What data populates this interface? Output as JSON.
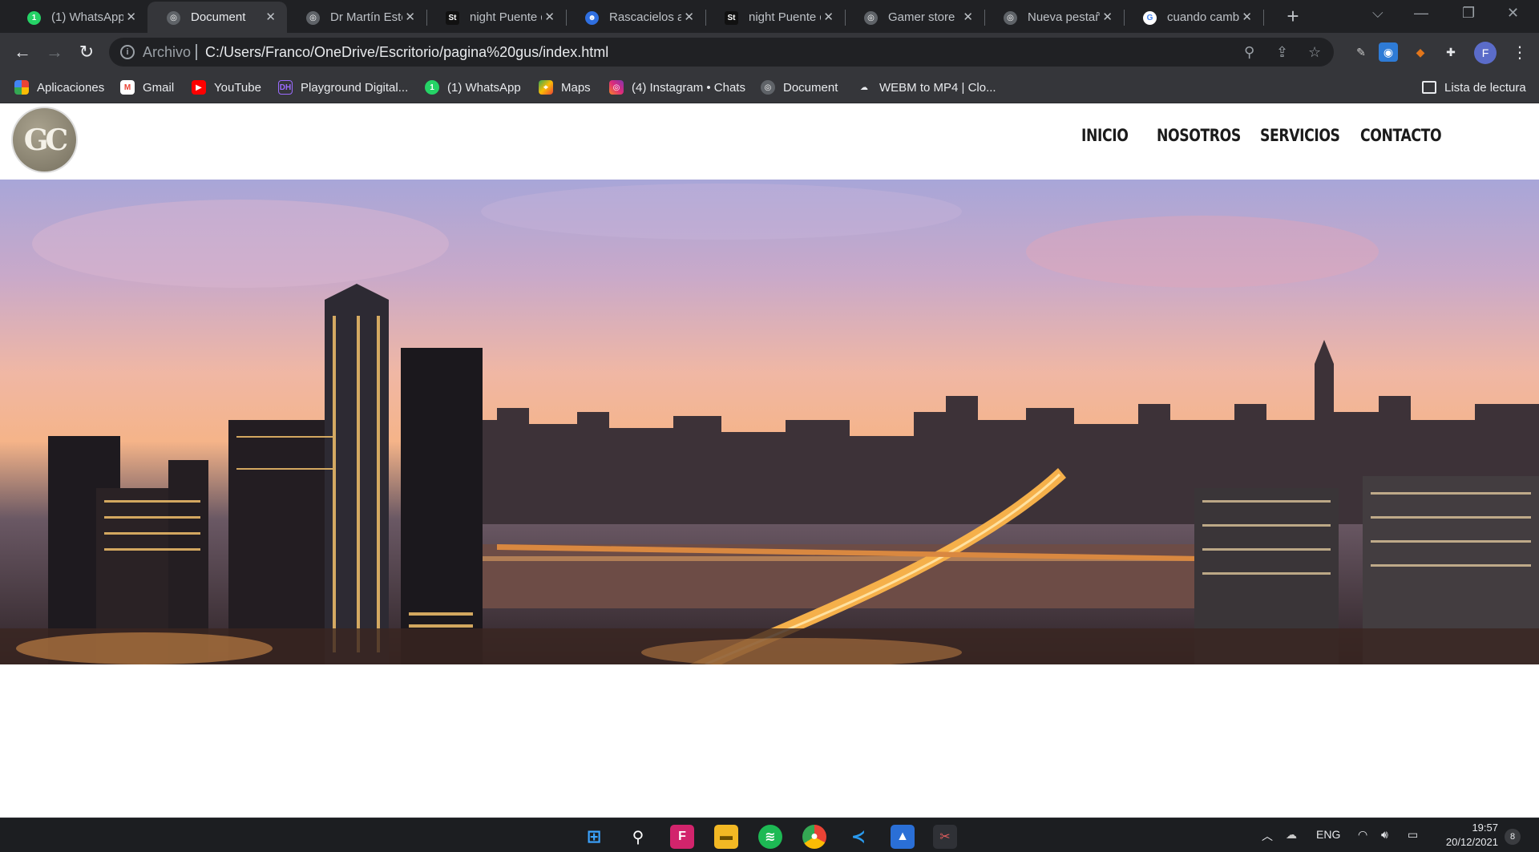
{
  "browser": {
    "tabs": [
      {
        "title": "(1) WhatsApp",
        "favicon": "whatsapp-icon",
        "active": false
      },
      {
        "title": "Document",
        "favicon": "globe-icon",
        "active": true
      },
      {
        "title": "Dr Martín Esteban",
        "favicon": "globe-icon",
        "active": false
      },
      {
        "title": "night Puente de",
        "favicon": "shutterstock-icon",
        "active": false
      },
      {
        "title": "Rascacielos al",
        "favicon": "robot-icon",
        "active": false
      },
      {
        "title": "night Puente de",
        "favicon": "shutterstock-icon",
        "active": false
      },
      {
        "title": "Gamer store",
        "favicon": "globe-icon",
        "active": false
      },
      {
        "title": "Nueva pestaña",
        "favicon": "globe-icon",
        "active": false
      },
      {
        "title": "cuando cambia",
        "favicon": "google-icon",
        "active": false
      }
    ],
    "address": {
      "scheme_label": "Archivo",
      "url": "C:/Users/Franco/OneDrive/Escritorio/pagina%20gus/index.html"
    },
    "profile_initial": "F",
    "bookmarks": [
      {
        "label": "Aplicaciones",
        "icon": "apps-grid-icon"
      },
      {
        "label": "Gmail",
        "icon": "gmail-icon"
      },
      {
        "label": "YouTube",
        "icon": "youtube-icon"
      },
      {
        "label": "Playground Digital...",
        "icon": "dh-icon"
      },
      {
        "label": "(1) WhatsApp",
        "icon": "whatsapp-icon"
      },
      {
        "label": "Maps",
        "icon": "maps-icon"
      },
      {
        "label": "(4) Instagram • Chats",
        "icon": "instagram-icon"
      },
      {
        "label": "Document",
        "icon": "globe-icon"
      },
      {
        "label": "WEBM to MP4 | Clo...",
        "icon": "cloudconvert-icon"
      }
    ],
    "reading_list": "Lista de lectura"
  },
  "site": {
    "logo_text": "GC",
    "nav": [
      "INICIO",
      "NOSOTROS",
      "SERVICIOS",
      "CONTACTO"
    ]
  },
  "taskbar": {
    "language": "ENG",
    "time": "19:57",
    "date": "20/12/2021",
    "notifications": "8"
  }
}
